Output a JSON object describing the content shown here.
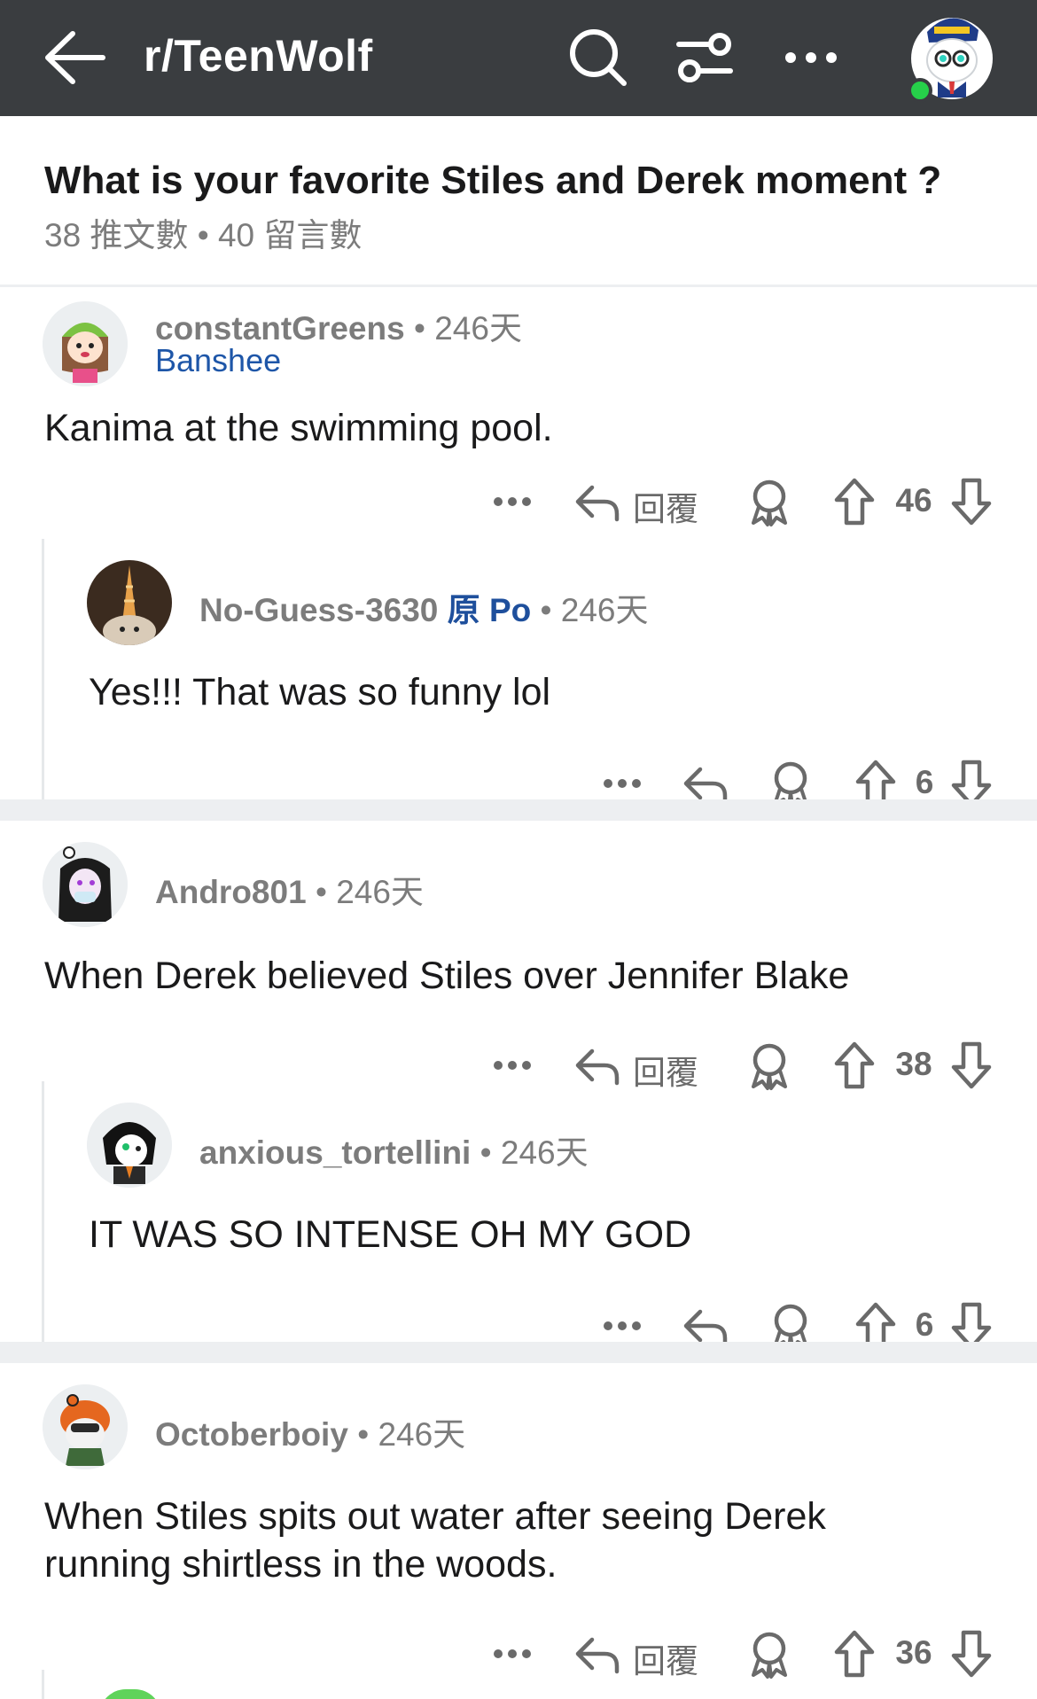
{
  "topbar": {
    "subreddit": "r/TeenWolf",
    "icons": [
      "back-arrow-icon",
      "search-icon",
      "filter-icon",
      "more-icon",
      "user-avatar"
    ],
    "background": "#3a3d40"
  },
  "post": {
    "title": "What is your favorite Stiles and Derek moment ?",
    "meta": "38 推文數 • 40 留言數"
  },
  "labels": {
    "reply": "回覆",
    "sep": "•"
  },
  "comments": [
    {
      "author": "constantGreens",
      "age": "246天",
      "flair": "Banshee",
      "body": "Kanima at the swimming pool.",
      "votes": "46",
      "replies": [
        {
          "author": "No-Guess-3630",
          "op_badge": "原 Po",
          "age": "246天",
          "body": "Yes!!! That was so funny lol",
          "votes": "6"
        }
      ]
    },
    {
      "author": "Andro801",
      "age": "246天",
      "body": "When Derek believed Stiles over Jennifer Blake",
      "votes": "38",
      "replies": [
        {
          "author": "anxious_tortellini",
          "age": "246天",
          "body": "IT WAS SO INTENSE OH MY GOD",
          "votes": "6"
        }
      ]
    },
    {
      "author": "Octoberboiy",
      "age": "246天",
      "body": "When Stiles spits out water after seeing Derek running shirtless in the woods.",
      "votes": "36"
    }
  ]
}
